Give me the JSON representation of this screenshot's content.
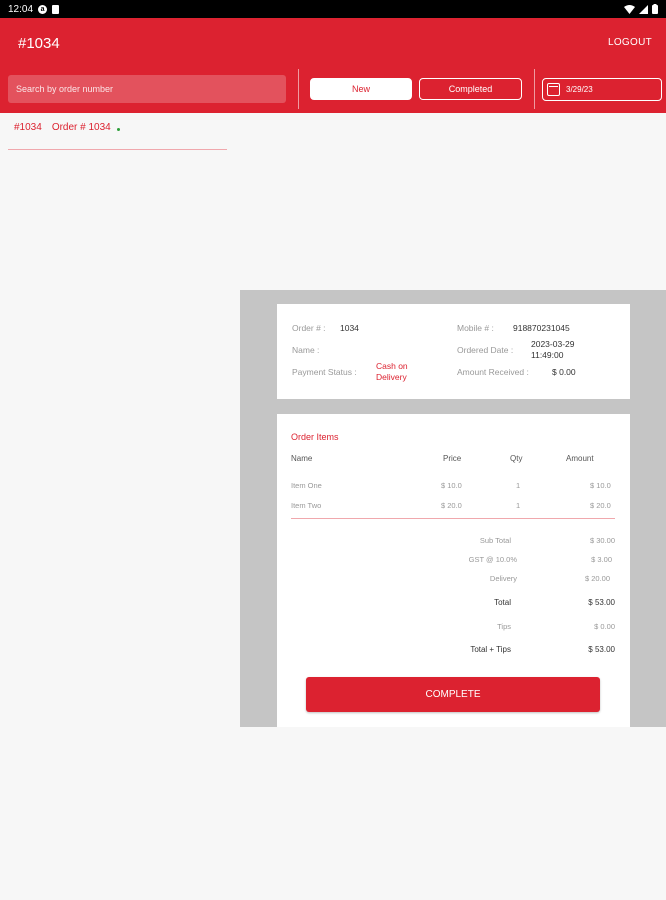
{
  "status_bar": {
    "time": "12:04"
  },
  "header": {
    "title": "#1034",
    "logout_label": "LOGOUT",
    "search_placeholder": "Search by order number",
    "tab_new": "New",
    "tab_completed": "Completed",
    "date": "3/29/23"
  },
  "order_list": [
    {
      "id": "#1034",
      "label": "Order # 1034"
    }
  ],
  "order_info": {
    "order_label": "Order # :",
    "order_value": "1034",
    "name_label": "Name :",
    "name_value": "",
    "payment_label": "Payment Status :",
    "payment_value": "Cash on Delivery",
    "mobile_label": "Mobile # :",
    "mobile_value": "918870231045",
    "ordered_date_label": "Ordered Date :",
    "ordered_date_value": "2023-03-29 11:49:00",
    "amount_label": "Amount Received :",
    "amount_value": "$ 0.00"
  },
  "order_items": {
    "title": "Order Items",
    "headers": {
      "name": "Name",
      "price": "Price",
      "qty": "Qty",
      "amount": "Amount"
    },
    "rows": [
      {
        "name": "Item One",
        "price": "$ 10.0",
        "qty": "1",
        "amount": "$ 10.0"
      },
      {
        "name": "Item Two",
        "price": "$ 20.0",
        "qty": "1",
        "amount": "$ 20.0"
      }
    ],
    "summary": [
      {
        "label": "Sub Total",
        "value": "$ 30.00"
      },
      {
        "label": "GST @ 10.0%",
        "value": "$ 3.00"
      },
      {
        "label": "Delivery",
        "value": "$ 20.00"
      },
      {
        "label": "Total",
        "value": "$ 53.00"
      },
      {
        "label": "Tips",
        "value": "$ 0.00"
      },
      {
        "label": "Total + Tips",
        "value": "$ 53.00"
      }
    ],
    "complete_label": "COMPLETE"
  },
  "colors": {
    "brand": "#dc2230",
    "panel": "#c5c5c5",
    "status_green": "#2e9e3a"
  }
}
